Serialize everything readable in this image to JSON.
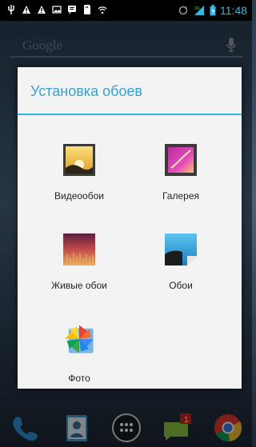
{
  "status_bar": {
    "time": "11:48"
  },
  "launcher": {
    "search_placeholder": "Google"
  },
  "dialog": {
    "title": "Установка обоев",
    "options": [
      {
        "label": "Видеообои",
        "icon": "video-wallpaper-icon"
      },
      {
        "label": "Галерея",
        "icon": "gallery-icon"
      },
      {
        "label": "Живые обои",
        "icon": "live-wallpaper-icon"
      },
      {
        "label": "Обои",
        "icon": "wallpaper-icon"
      },
      {
        "label": "Фото",
        "icon": "photos-icon"
      }
    ]
  },
  "colors": {
    "accent": "#33b5e5",
    "dialog_background": "#f3f3f3"
  }
}
